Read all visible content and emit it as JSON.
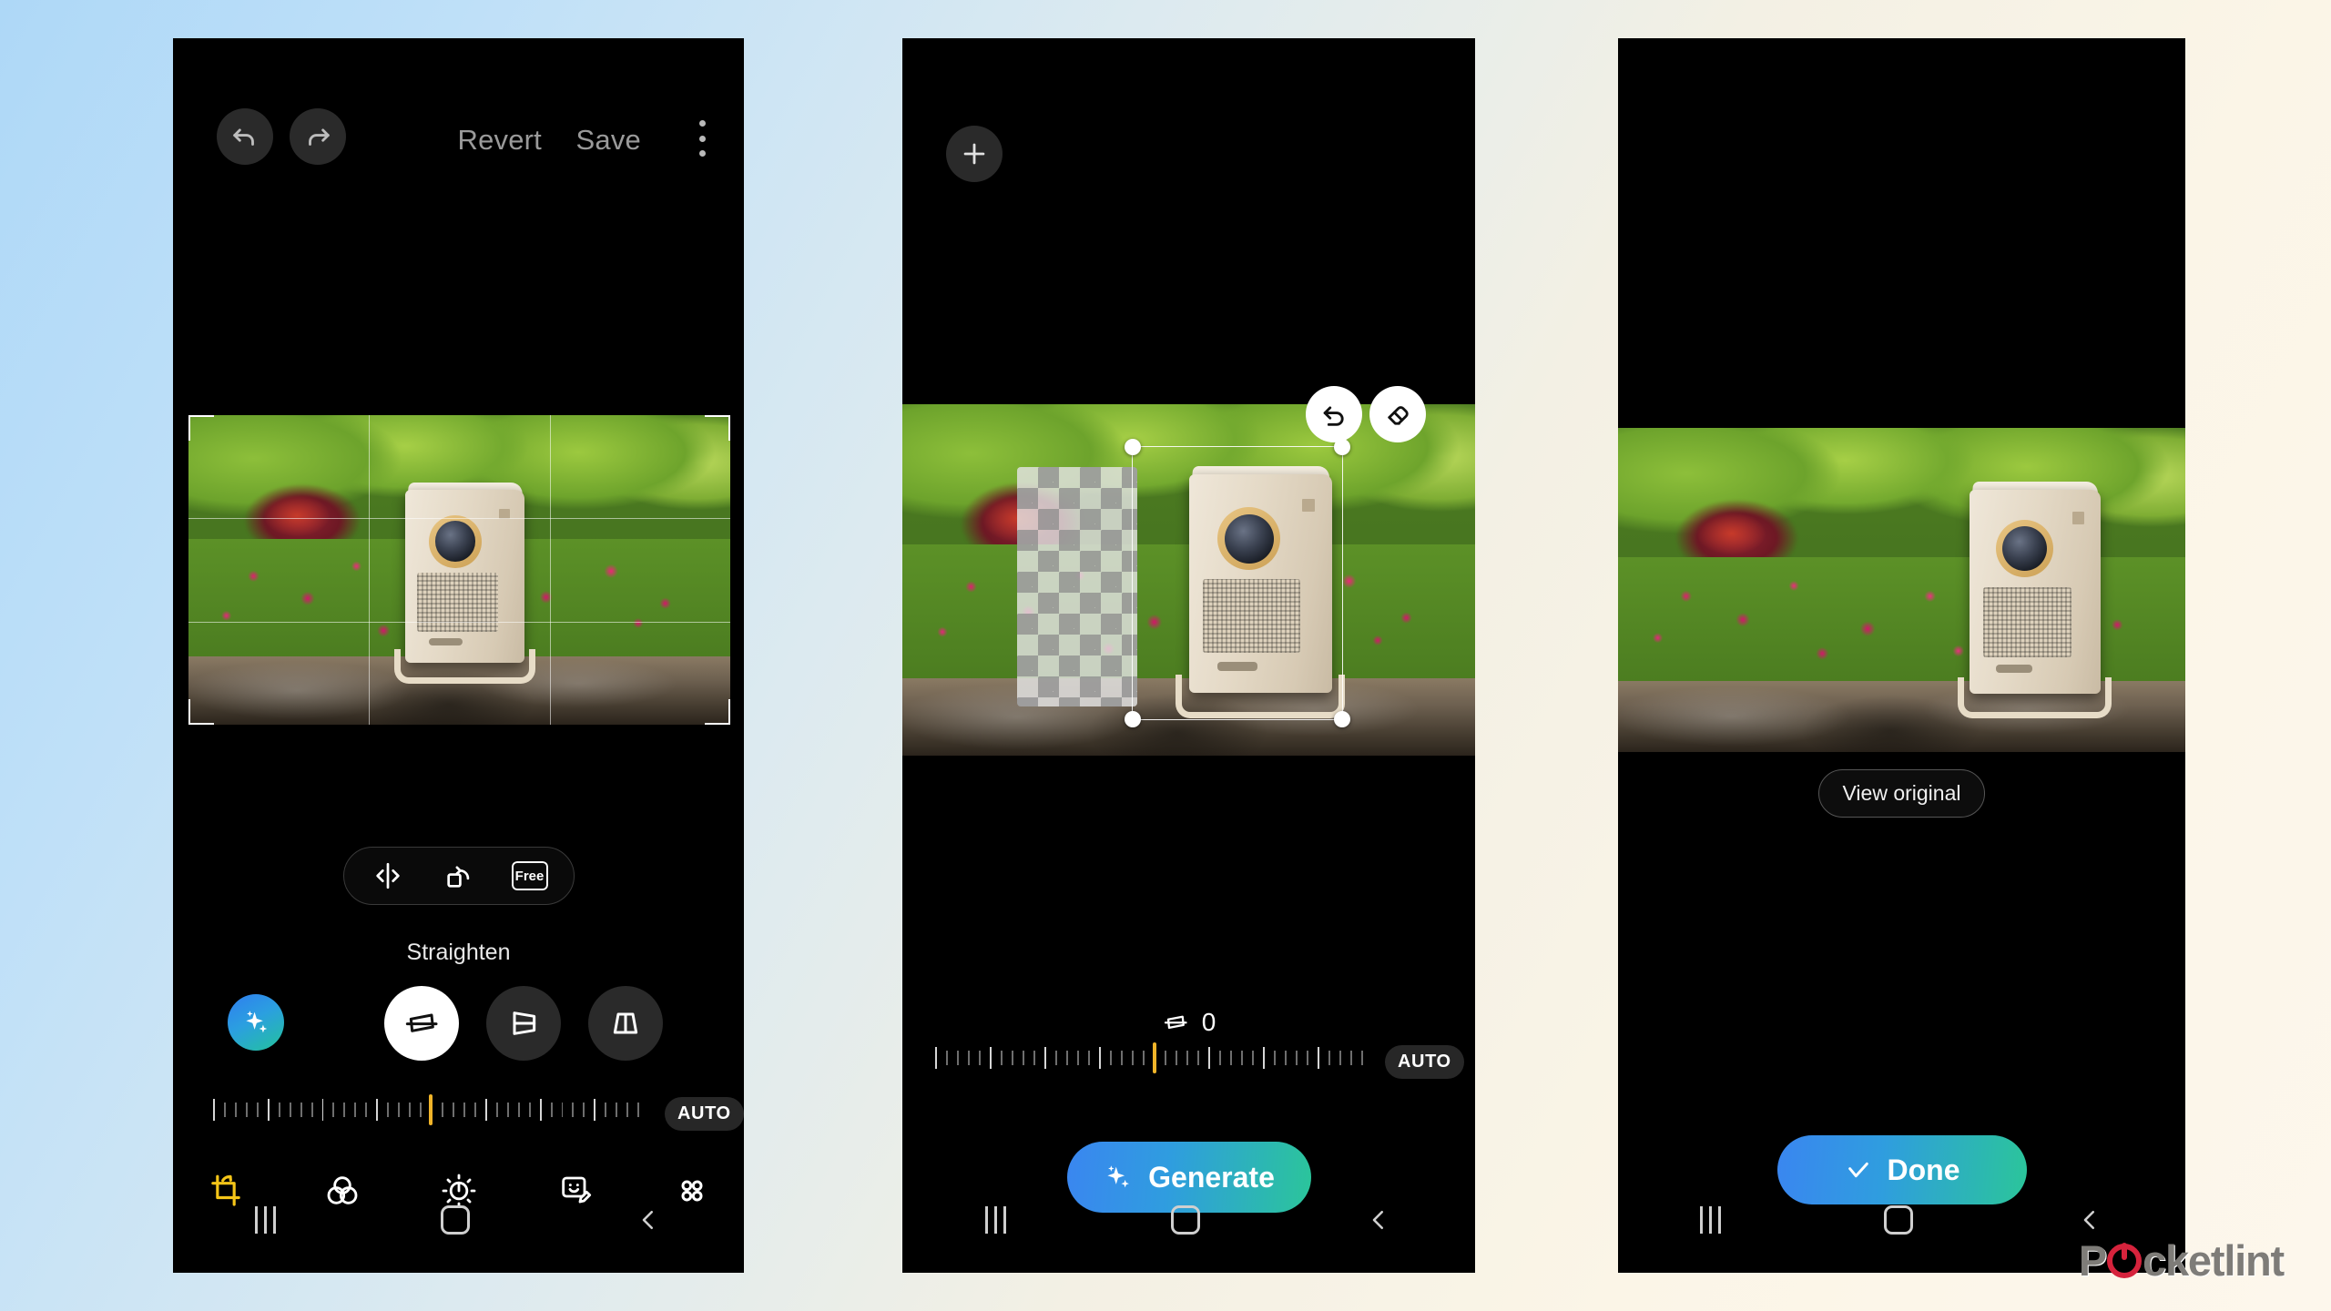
{
  "background": {
    "left_color": "#aed8f7",
    "right_color": "#fdf7ec"
  },
  "watermark": {
    "text_before": "P",
    "text_after": "cketlint",
    "accent": "#d6233c"
  },
  "phone1": {
    "name": "crop-and-straighten-screen",
    "topbar": {
      "undo_icon": "undo-icon",
      "redo_icon": "redo-icon",
      "revert_label": "Revert",
      "save_label": "Save",
      "more_icon": "kebab-menu-icon"
    },
    "crop_tools": {
      "flip_icon": "flip-horizontal-icon",
      "rotate_icon": "rotate-left-icon",
      "aspect_label": "Free"
    },
    "perspective": {
      "section_label": "Straighten",
      "ai_icon": "ai-sparkle-icon",
      "buttons": [
        {
          "name": "straighten-button",
          "icon": "straighten-icon",
          "active": true
        },
        {
          "name": "horizontal-perspective-button",
          "icon": "horizontal-perspective-icon",
          "active": false
        },
        {
          "name": "vertical-perspective-button",
          "icon": "vertical-perspective-icon",
          "active": false
        }
      ]
    },
    "slider": {
      "auto_label": "AUTO",
      "value": 0
    },
    "bottom_tools": [
      {
        "name": "tool-crop",
        "icon": "crop-rotate-icon",
        "label": "Crop",
        "active": true
      },
      {
        "name": "tool-filters",
        "icon": "color-filters-icon",
        "label": "Filters",
        "active": false
      },
      {
        "name": "tool-adjust",
        "icon": "brightness-icon",
        "label": "Adjust",
        "active": false
      },
      {
        "name": "tool-decorate",
        "icon": "sticker-draw-icon",
        "label": "Decorate",
        "active": false
      },
      {
        "name": "tool-more",
        "icon": "more-dots-icon",
        "label": "More",
        "active": false
      }
    ],
    "navbar": {
      "recents": "recents-icon",
      "home": "home-icon",
      "back": "back-icon"
    }
  },
  "phone2": {
    "name": "generative-edit-screen",
    "add_button_icon": "plus-icon",
    "floating": {
      "undo_icon": "undo-icon",
      "erase_icon": "eraser-icon"
    },
    "value_row": {
      "icon": "straighten-icon",
      "value": "0"
    },
    "slider": {
      "auto_label": "AUTO",
      "value": 0
    },
    "generate_button": {
      "label": "Generate",
      "icon": "ai-sparkle-icon"
    },
    "navbar": {
      "recents": "recents-icon",
      "home": "home-icon",
      "back": "back-icon"
    }
  },
  "phone3": {
    "name": "result-preview-screen",
    "view_original_label": "View original",
    "done_button": {
      "label": "Done",
      "icon": "check-icon"
    },
    "navbar": {
      "recents": "recents-icon",
      "home": "home-icon",
      "back": "back-icon"
    }
  }
}
